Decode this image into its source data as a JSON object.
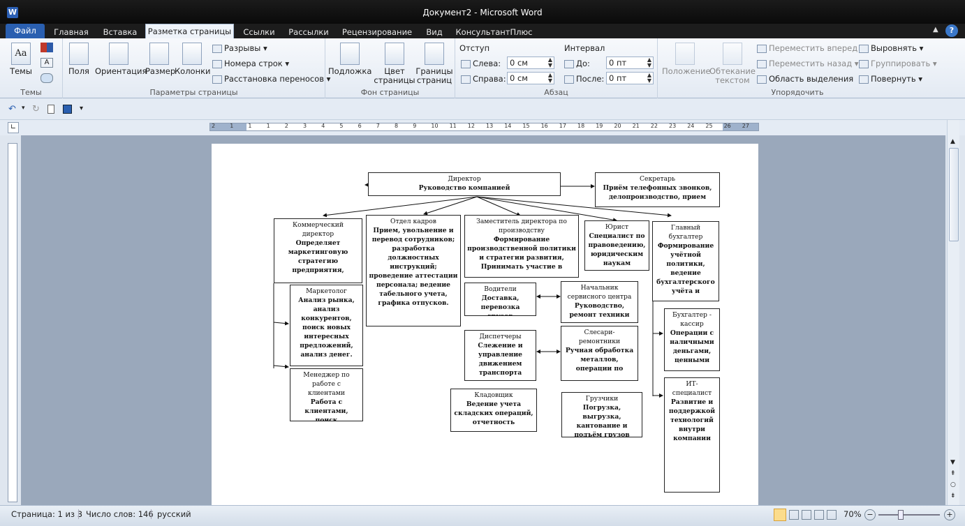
{
  "window": {
    "title": "Документ2 - Microsoft Word",
    "app_icon": "W"
  },
  "tabs": [
    "Файл",
    "Главная",
    "Вставка",
    "Разметка страницы",
    "Ссылки",
    "Рассылки",
    "Рецензирование",
    "Вид",
    "КонсультантПлюс"
  ],
  "ribbon": {
    "themes": {
      "btn": "Темы",
      "label": "Темы"
    },
    "page_setup": {
      "fields": "Поля",
      "orientation": "Ориентация",
      "size": "Размер",
      "columns": "Колонки",
      "breaks": "Разрывы",
      "line_numbers": "Номера строк",
      "hyphenation": "Расстановка переносов",
      "label": "Параметры страницы"
    },
    "page_bg": {
      "watermark": "Подложка",
      "color1": "Цвет",
      "color2": "страницы",
      "borders1": "Границы",
      "borders2": "страниц",
      "label": "Фон страницы"
    },
    "paragraph": {
      "indent": "Отступ",
      "left": "Слева:",
      "left_val": "0 см",
      "right": "Справа:",
      "right_val": "0 см",
      "spacing": "Интервал",
      "before": "До:",
      "before_val": "0 пт",
      "after": "После:",
      "after_val": "0 пт",
      "label": "Абзац"
    },
    "arrange": {
      "position1": "Положение",
      "wrap1": "Обтекание",
      "wrap2": "текстом",
      "forward": "Переместить вперед",
      "backward": "Переместить назад",
      "selection": "Область выделения",
      "align": "Выровнять",
      "group": "Группировать",
      "rotate": "Повернуть",
      "label": "Упорядочить"
    }
  },
  "status": {
    "page": "Страница: 1 из 3",
    "words": "Число слов: 146",
    "lang": "русский",
    "zoom": "70%"
  },
  "ruler": {
    "hnums": [
      "2",
      "1",
      "1",
      "1",
      "2",
      "3",
      "4",
      "5",
      "6",
      "7",
      "8",
      "9",
      "10",
      "11",
      "12",
      "13",
      "14",
      "15",
      "16",
      "17",
      "18",
      "19",
      "20",
      "21",
      "22",
      "23",
      "24",
      "25",
      "26",
      "27"
    ]
  },
  "org": {
    "director": {
      "t": "Директор",
      "d": "Руководство компанией"
    },
    "secretary": {
      "t": "Секретарь",
      "d": "Приём телефонных звонков, делопроизводство, прием"
    },
    "commercial": {
      "t": "Коммерческий директор",
      "d": "Определяет маркетинговую стратегию предприятия,"
    },
    "hr": {
      "t": "Отдел кадров",
      "d": "Прием, увольнение и перевод сотрудников; разработка должностных инструкций; проведение аттестации персонала; ведение табельного учета, графика отпусков."
    },
    "deputy": {
      "t": "Заместитель директора по производству",
      "d": "Формирование производственной политики и стратегии развития, Принимать участие в"
    },
    "lawyer": {
      "t": "Юрист",
      "d": "Специалист по правоведению, юридическим наукам"
    },
    "accountant": {
      "t": "Главный бухгалтер",
      "d": "Формирование учётной политики, ведение бухгалтерского учёта и"
    },
    "marketer": {
      "t": "Маркетолог",
      "d": "Анализ рынка, анализ конкурентов, поиск новых интересных предложений, анализ денег."
    },
    "client_mgr": {
      "t": "Менеджер по работе с клиентами",
      "d": "Работа с клиентами, поиск"
    },
    "drivers": {
      "t": "Водители",
      "d": "Доставка, перевозка грузов"
    },
    "service_head": {
      "t": "Начальник сервисного центра",
      "d": "Руководство, ремонт техники"
    },
    "dispatchers": {
      "t": "Диспетчеры",
      "d": "Слежение и управление движением транспорта"
    },
    "mechanics": {
      "t": "Слесари-ремонтники",
      "d": "Ручная обработка металлов, операции по"
    },
    "storekeeper": {
      "t": "Кладовщик",
      "d": "Ведение учета складских операций, отчетность"
    },
    "loaders": {
      "t": "Грузчики",
      "d": "Погрузка, выгрузка, кантование и подъём грузов"
    },
    "cashier": {
      "t": "Бухгалтер - кассир",
      "d": "Операции с наличными деньгами, ценными"
    },
    "it": {
      "t": "ИТ-специалист",
      "d": "Развитие и поддержкой технологий внутри компании"
    }
  }
}
